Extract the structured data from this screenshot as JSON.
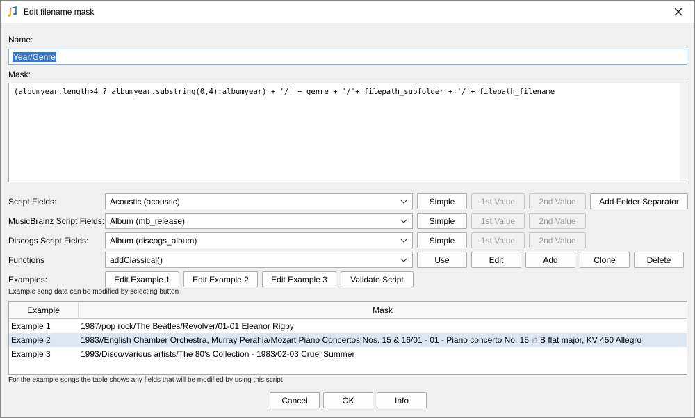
{
  "window": {
    "title": "Edit filename mask"
  },
  "name": {
    "label": "Name:",
    "value": "Year/Genre"
  },
  "mask": {
    "label": "Mask:",
    "value": "(albumyear.length>4 ? albumyear.substring(0,4):albumyear) + '/' + genre + '/'+ filepath_subfolder + '/'+ filepath_filename"
  },
  "script_fields": {
    "label": "Script Fields:",
    "selected": "Acoustic (acoustic)",
    "simple": "Simple",
    "first": "1st Value",
    "second": "2nd Value",
    "add_sep": "Add Folder Separator"
  },
  "mb_fields": {
    "label": "MusicBrainz Script Fields:",
    "selected": "Album (mb_release)",
    "simple": "Simple",
    "first": "1st Value",
    "second": "2nd Value"
  },
  "discogs_fields": {
    "label": "Discogs Script Fields:",
    "selected": "Album (discogs_album)",
    "simple": "Simple",
    "first": "1st Value",
    "second": "2nd Value"
  },
  "functions": {
    "label": "Functions",
    "selected": "addClassical()",
    "use": "Use",
    "edit": "Edit",
    "add": "Add",
    "clone": "Clone",
    "delete": "Delete"
  },
  "examples": {
    "label": "Examples:",
    "ex1": "Edit Example 1",
    "ex2": "Edit Example 2",
    "ex3": "Edit Example 3",
    "validate": "Validate Script",
    "note": "Example song data can be modified by selecting button"
  },
  "table": {
    "headers": [
      "Example",
      "Mask"
    ],
    "rows": [
      {
        "example": "Example 1",
        "mask": "1987/pop rock/The Beatles/Revolver/01-01 Eleanor Rigby"
      },
      {
        "example": "Example 2",
        "mask": "1983//English Chamber Orchestra, Murray Perahia/Mozart Piano Concertos Nos. 15 & 16/01 - 01 - Piano concerto No. 15 in B flat major, KV 450 Allegro"
      },
      {
        "example": "Example 3",
        "mask": "1993/Disco/various artists/The 80's Collection - 1983/02-03 Cruel Summer"
      }
    ],
    "selected_row": 1
  },
  "footer_note": "For the example songs the table shows any fields that will be modified by using this script",
  "buttons": {
    "cancel": "Cancel",
    "ok": "OK",
    "info": "Info"
  },
  "colors": {
    "selection": "#3575d3",
    "row_selected": "#dde6f0",
    "focus_border": "#7eb4ea"
  }
}
